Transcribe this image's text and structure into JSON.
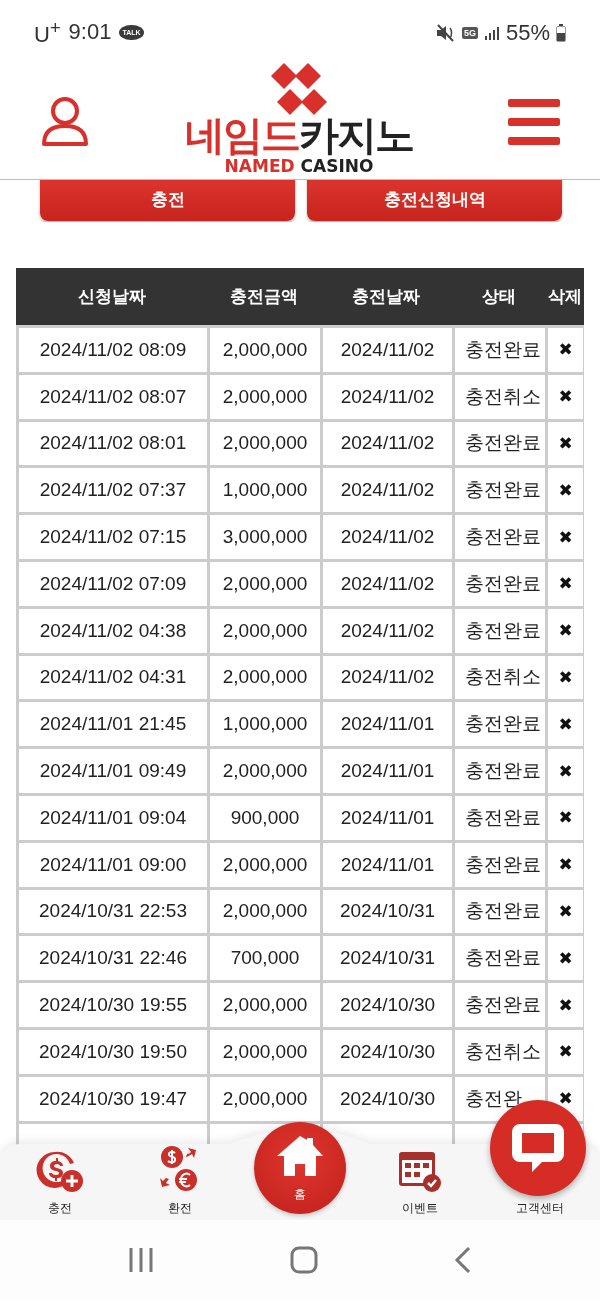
{
  "status_bar": {
    "carrier": "U$^{+}$",
    "time": "9:01",
    "app_badge": "TALK",
    "network": "5G",
    "battery": "55%"
  },
  "header": {
    "logo": {
      "title_red": "네임드",
      "title_dark": "카지노",
      "subtitle_red": "NAMED",
      "subtitle_dark": "CASINO"
    }
  },
  "buttons": [
    "충전",
    "충전신청내역"
  ],
  "table": {
    "columns": [
      "신청날짜",
      "충전금액",
      "충전날짜",
      "상태",
      "삭제"
    ],
    "rows": [
      {
        "requested": "2024/11/02 08:09",
        "amount": "2,000,000",
        "charged": "2024/11/02",
        "status": "충전완료",
        "delete": "✖"
      },
      {
        "requested": "2024/11/02 08:07",
        "amount": "2,000,000",
        "charged": "2024/11/02",
        "status": "충전취소",
        "delete": "✖"
      },
      {
        "requested": "2024/11/02 08:01",
        "amount": "2,000,000",
        "charged": "2024/11/02",
        "status": "충전완료",
        "delete": "✖"
      },
      {
        "requested": "2024/11/02 07:37",
        "amount": "1,000,000",
        "charged": "2024/11/02",
        "status": "충전완료",
        "delete": "✖"
      },
      {
        "requested": "2024/11/02 07:15",
        "amount": "3,000,000",
        "charged": "2024/11/02",
        "status": "충전완료",
        "delete": "✖"
      },
      {
        "requested": "2024/11/02 07:09",
        "amount": "2,000,000",
        "charged": "2024/11/02",
        "status": "충전완료",
        "delete": "✖"
      },
      {
        "requested": "2024/11/02 04:38",
        "amount": "2,000,000",
        "charged": "2024/11/02",
        "status": "충전완료",
        "delete": "✖"
      },
      {
        "requested": "2024/11/02 04:31",
        "amount": "2,000,000",
        "charged": "2024/11/02",
        "status": "충전취소",
        "delete": "✖"
      },
      {
        "requested": "2024/11/01 21:45",
        "amount": "1,000,000",
        "charged": "2024/11/01",
        "status": "충전완료",
        "delete": "✖"
      },
      {
        "requested": "2024/11/01 09:49",
        "amount": "2,000,000",
        "charged": "2024/11/01",
        "status": "충전완료",
        "delete": "✖"
      },
      {
        "requested": "2024/11/01 09:04",
        "amount": "900,000",
        "charged": "2024/11/01",
        "status": "충전완료",
        "delete": "✖"
      },
      {
        "requested": "2024/11/01 09:00",
        "amount": "2,000,000",
        "charged": "2024/11/01",
        "status": "충전완료",
        "delete": "✖"
      },
      {
        "requested": "2024/10/31 22:53",
        "amount": "2,000,000",
        "charged": "2024/10/31",
        "status": "충전완료",
        "delete": "✖"
      },
      {
        "requested": "2024/10/31 22:46",
        "amount": "700,000",
        "charged": "2024/10/31",
        "status": "충전완료",
        "delete": "✖"
      },
      {
        "requested": "2024/10/30 19:55",
        "amount": "2,000,000",
        "charged": "2024/10/30",
        "status": "충전완료",
        "delete": "✖"
      },
      {
        "requested": "2024/10/30 19:50",
        "amount": "2,000,000",
        "charged": "2024/10/30",
        "status": "충전취소",
        "delete": "✖"
      },
      {
        "requested": "2024/10/30 19:47",
        "amount": "2,000,000",
        "charged": "2024/10/30",
        "status": "충전완",
        "delete": "✖"
      }
    ]
  },
  "bottom_nav": {
    "items": [
      {
        "kind": "deposit",
        "label": "충전"
      },
      {
        "kind": "exchange",
        "label": "환전"
      },
      {
        "kind": "home",
        "label": "홈"
      },
      {
        "kind": "event",
        "label": "이벤트"
      },
      {
        "kind": "support",
        "label": "고객센터"
      }
    ]
  }
}
